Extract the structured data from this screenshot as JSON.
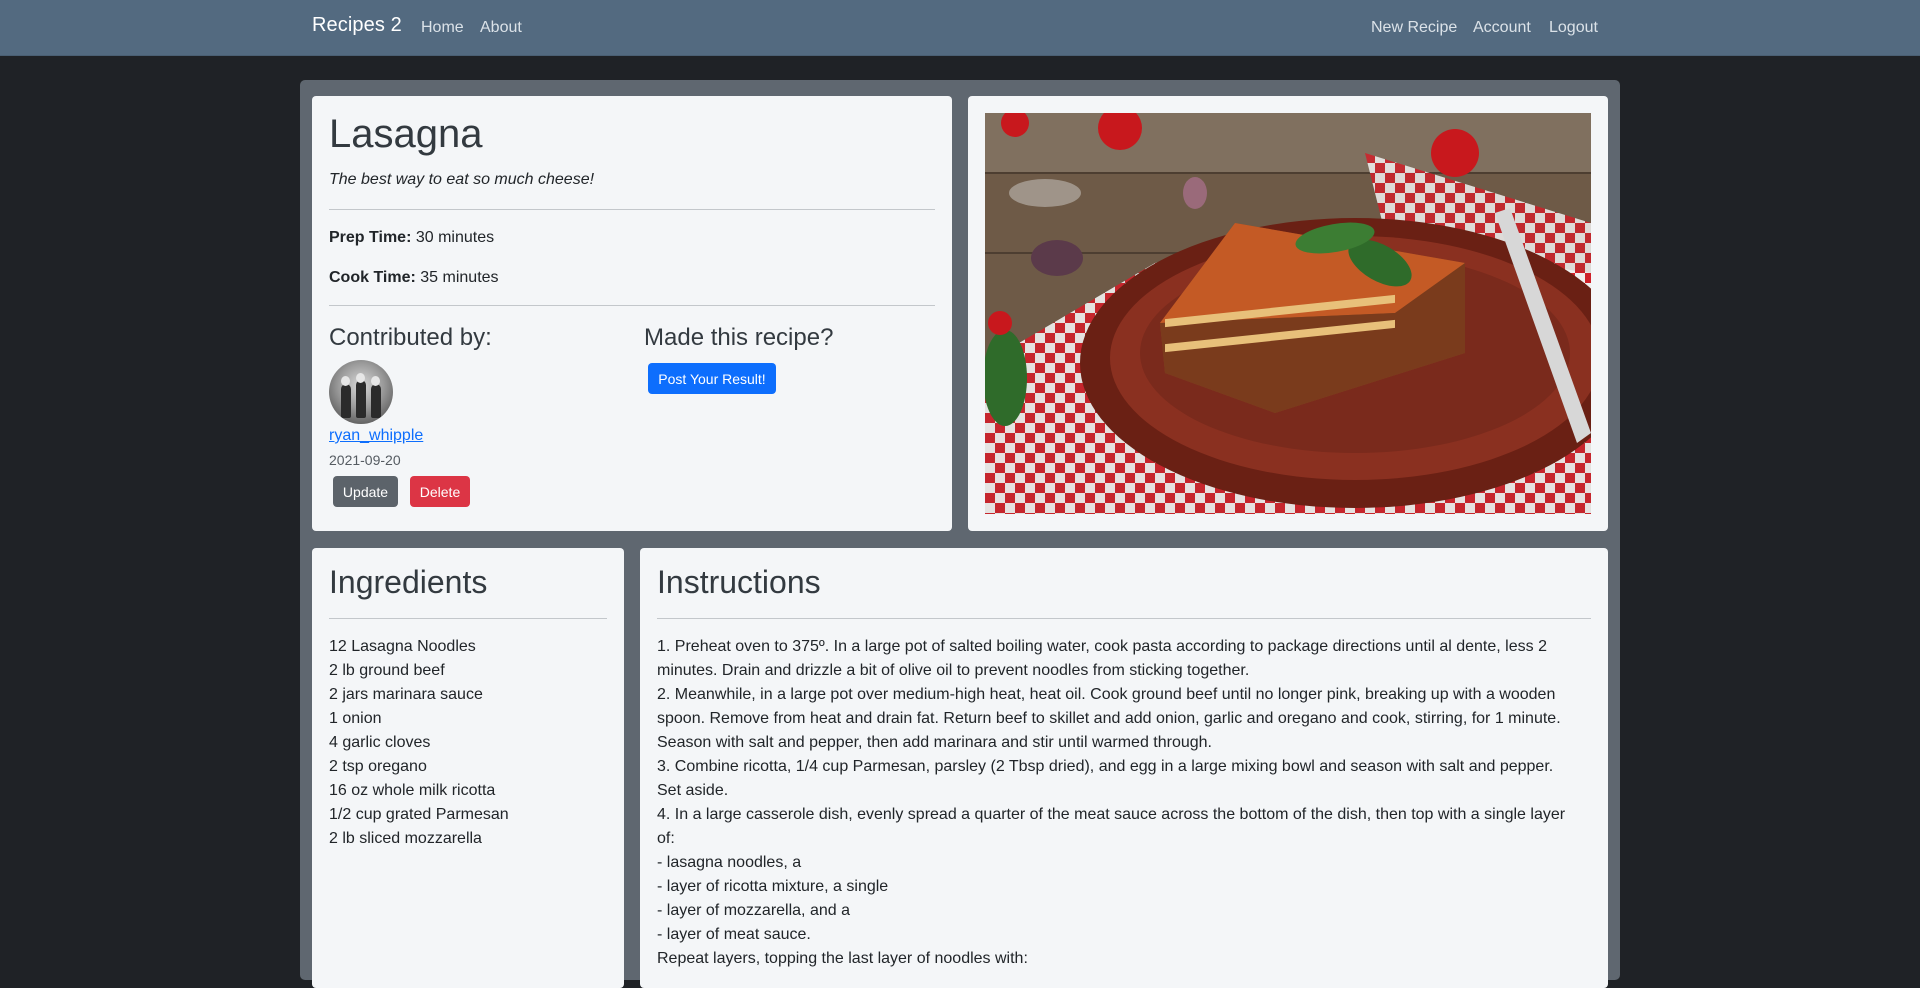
{
  "nav": {
    "brand": "Recipes 2",
    "left_links": [
      "Home",
      "About"
    ],
    "right_links": [
      "New Recipe",
      "Account",
      "Logout"
    ]
  },
  "recipe": {
    "title": "Lasagna",
    "subtitle": "The best way to eat so much cheese!",
    "prep_label": "Prep Time:",
    "prep_value": "30 minutes",
    "cook_label": "Cook Time:",
    "cook_value": "35 minutes"
  },
  "contributor": {
    "heading": "Contributed by:",
    "username": "ryan_whipple",
    "date": "2021-09-20",
    "update_label": "Update",
    "delete_label": "Delete"
  },
  "made": {
    "heading": "Made this recipe?",
    "post_label": "Post Your Result!"
  },
  "ingredients": {
    "heading": "Ingredients",
    "items": [
      "12 Lasagna Noodles",
      "2 lb ground beef",
      "2 jars marinara sauce",
      "1 onion",
      "4 garlic cloves",
      "2 tsp oregano",
      "16 oz whole milk ricotta",
      "1/2 cup grated Parmesan",
      "2 lb sliced mozzarella"
    ]
  },
  "instructions": {
    "heading": "Instructions",
    "lines": [
      "1. Preheat oven to 375º. In a large pot of salted boiling water, cook pasta according to package directions until al dente, less 2",
      "minutes. Drain and drizzle a bit of olive oil to prevent noodles from sticking together.",
      "2. Meanwhile, in a large pot over medium-high heat, heat oil. Cook ground beef until no longer pink, breaking up with a wooden",
      "spoon. Remove from heat and drain fat. Return beef to skillet and add onion, garlic and oregano and cook, stirring, for 1 minute.",
      "Season with salt and pepper, then add marinara and stir until warmed through.",
      "3. Combine ricotta, 1/4 cup Parmesan, parsley (2 Tbsp dried), and egg in a large mixing bowl and season with salt and pepper.",
      "Set aside.",
      "4. In a large casserole dish, evenly spread a quarter of the meat sauce across the bottom of the dish, then top with a single layer",
      "of:",
      "- lasagna noodles, a",
      "- layer of ricotta mixture, a single",
      "- layer of mozzarella, and a",
      "- layer of meat sauce.",
      "Repeat layers, topping the last layer of noodles with:"
    ]
  },
  "colors": {
    "navbar": "#536a80",
    "primary": "#0d6efd",
    "danger": "#dc3545",
    "secondary": "#5c636a"
  }
}
